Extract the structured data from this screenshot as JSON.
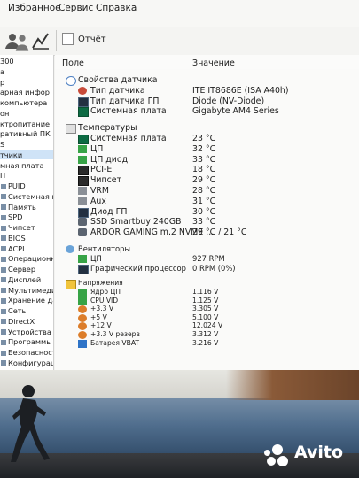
{
  "menu": [
    "Избранное",
    "Сервис",
    "Справка"
  ],
  "toolbar": {
    "report_label": "Отчёт"
  },
  "sidebar": {
    "items": [
      "300",
      "а",
      "р",
      "арная инфор",
      "компьютера",
      "он",
      "ктропитание",
      "ративный ПК",
      "S",
      "тчики",
      "мная плата",
      "П",
      "PUID",
      "Системная плата",
      "Память",
      "SPD",
      "Чипсет",
      "BIOS",
      "ACPI",
      "Операционная систем",
      "Сервер",
      "Дисплей",
      "Мультимедиа",
      "Хранение данных",
      "Сеть",
      "DirectX",
      "Устройства",
      "Программы",
      "Безопасность",
      "Конфигурация"
    ],
    "selected_index": 9
  },
  "columns": {
    "field": "Поле",
    "value": "Значение"
  },
  "rows": [
    {
      "type": "group",
      "icon": "info-icon",
      "field": "Свойства датчика",
      "value": ""
    },
    {
      "type": "item",
      "icon": "sensor-icon",
      "field": "Тип датчика",
      "value": "ITE IT8686E  (ISA A40h)"
    },
    {
      "type": "item",
      "icon": "gpu-icon",
      "field": "Тип датчика ГП",
      "value": "Diode  (NV-Diode)"
    },
    {
      "type": "item",
      "icon": "motherboard-icon",
      "field": "Системная плата",
      "value": "Gigabyte AM4 Series"
    },
    {
      "type": "spacer"
    },
    {
      "type": "group",
      "icon": "temperature-icon",
      "field": "Температуры",
      "value": ""
    },
    {
      "type": "item",
      "icon": "motherboard-icon",
      "field": "Системная плата",
      "value": "23 °C"
    },
    {
      "type": "item",
      "icon": "cpu-icon",
      "field": "ЦП",
      "value": "32 °C"
    },
    {
      "type": "item",
      "icon": "cpu-icon",
      "field": "ЦП диод",
      "value": "33 °C"
    },
    {
      "type": "item",
      "icon": "chip-icon",
      "field": "PCI-E",
      "value": "18 °C"
    },
    {
      "type": "item",
      "icon": "chip-icon",
      "field": "Чипсет",
      "value": "29 °C"
    },
    {
      "type": "item",
      "icon": "vrm-icon",
      "field": "VRM",
      "value": "28 °C"
    },
    {
      "type": "item",
      "icon": "aux-icon",
      "field": "Aux",
      "value": "31 °C"
    },
    {
      "type": "item",
      "icon": "gpu-icon",
      "field": "Диод ГП",
      "value": "30 °C"
    },
    {
      "type": "item",
      "icon": "hdd-icon",
      "field": "SSD Smartbuy 240GB",
      "value": "33 °C"
    },
    {
      "type": "item",
      "icon": "hdd-icon",
      "field": "ARDOR GAMING m.2 NVME ...",
      "value": "29 °C / 21 °C"
    },
    {
      "type": "spacer"
    },
    {
      "type": "group",
      "icon": "fan-icon",
      "field": "Вентиляторы",
      "value": ""
    },
    {
      "type": "item",
      "icon": "cpu-icon",
      "field": "ЦП",
      "value": "927 RPM"
    },
    {
      "type": "item",
      "icon": "gpu-icon",
      "field": "Графический процессор",
      "value": "0 RPM  (0%)"
    },
    {
      "type": "spacer"
    },
    {
      "type": "group",
      "icon": "voltage-icon",
      "field": "Напряжения",
      "value": ""
    },
    {
      "type": "item",
      "icon": "cpu-icon",
      "field": "Ядро ЦП",
      "value": "1.116 V"
    },
    {
      "type": "item",
      "icon": "cpu-icon",
      "field": "CPU VID",
      "value": "1.125 V"
    },
    {
      "type": "item",
      "icon": "voltage-plus-icon",
      "field": "+3.3 V",
      "value": "3.305 V"
    },
    {
      "type": "item",
      "icon": "voltage-plus-icon",
      "field": "+5 V",
      "value": "5.100 V"
    },
    {
      "type": "item",
      "icon": "voltage-plus-icon",
      "field": "+12 V",
      "value": "12.024 V"
    },
    {
      "type": "item",
      "icon": "voltage-plus-icon",
      "field": "+3.3 V резерв",
      "value": "3.312 V"
    },
    {
      "type": "item",
      "icon": "battery-icon",
      "field": "Батарея VBAT",
      "value": "3.216 V"
    }
  ],
  "watermark": {
    "brand": "Avito"
  },
  "colors": {
    "selection": "#cfe3f7",
    "window_bg": "#f3f3f1"
  }
}
